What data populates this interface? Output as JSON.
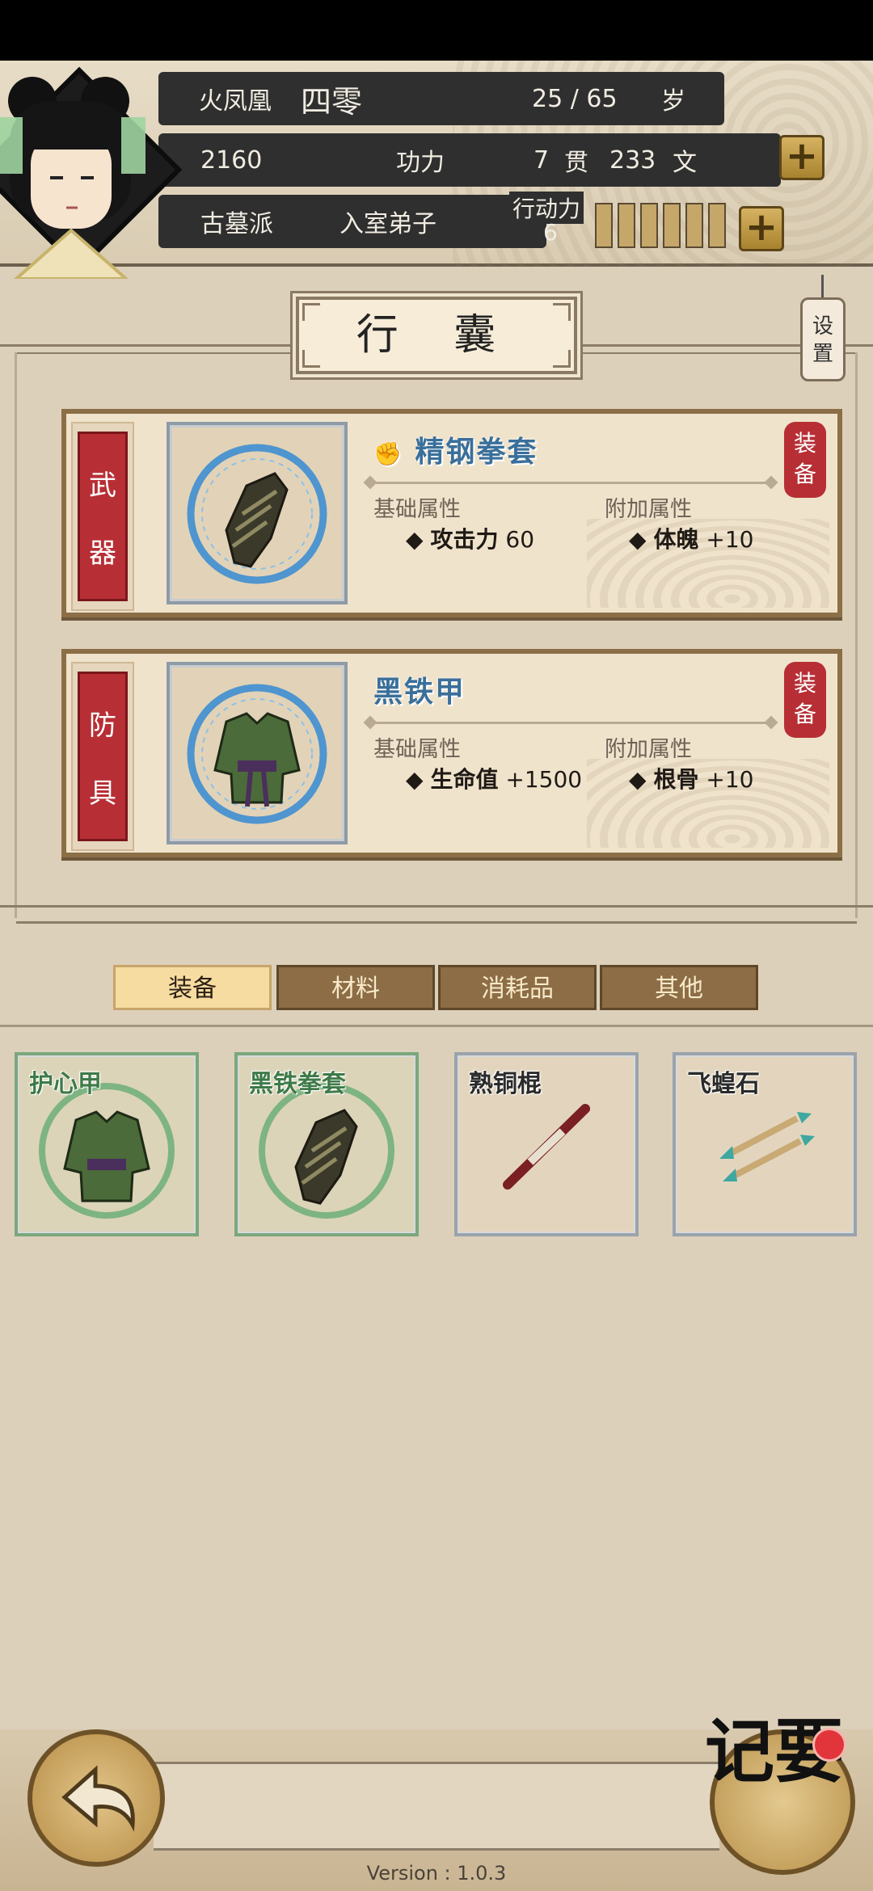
{
  "character": {
    "name": "火凤凰",
    "name_title": "四零",
    "age": "25 / 65",
    "age_unit": "岁",
    "power_value": "2160",
    "power_label": "功力",
    "money_guan": "7",
    "money_guan_unit": "贯",
    "money_wen": "233",
    "money_wen_unit": "文",
    "sect": "古墓派",
    "rank": "入室弟子",
    "stamina_label": "行动力",
    "stamina_value": "6",
    "stamina_cells": 6
  },
  "page_title": "行 囊",
  "settings_label": "设\n置",
  "equipped": [
    {
      "slot_label_1": "武",
      "slot_label_2": "器",
      "icon": "gauntlet-icon",
      "name": "精钢拳套",
      "base_head": "基础属性",
      "base_key": "攻击力",
      "base_val": "60",
      "extra_head": "附加属性",
      "extra_key": "体魄",
      "extra_val": "+10",
      "stamp": "装备"
    },
    {
      "slot_label_1": "防",
      "slot_label_2": "具",
      "icon": "armor-icon",
      "name": "黑铁甲",
      "base_head": "基础属性",
      "base_key": "生命值",
      "base_val": "+1500",
      "extra_head": "附加属性",
      "extra_key": "根骨",
      "extra_val": "+10",
      "stamp": "装备"
    }
  ],
  "tabs": [
    {
      "label": "装备",
      "active": true
    },
    {
      "label": "材料",
      "active": false
    },
    {
      "label": "消耗品",
      "active": false
    },
    {
      "label": "其他",
      "active": false
    }
  ],
  "inventory": [
    {
      "name": "护心甲",
      "rarity": "green",
      "icon": "armor-icon"
    },
    {
      "name": "黑铁拳套",
      "rarity": "green",
      "icon": "gauntlet-icon"
    },
    {
      "name": "熟铜棍",
      "rarity": "white",
      "icon": "staff-icon"
    },
    {
      "name": "飞蝗石",
      "rarity": "white",
      "icon": "darts-icon"
    }
  ],
  "bottom": {
    "memo_label": "记要",
    "version": "Version : 1.0.3"
  },
  "colors": {
    "accent_red": "#b72f35",
    "rare_green": "#3e7a48",
    "rare_blue": "#3a6f9a",
    "gold": "#c6a76a"
  }
}
